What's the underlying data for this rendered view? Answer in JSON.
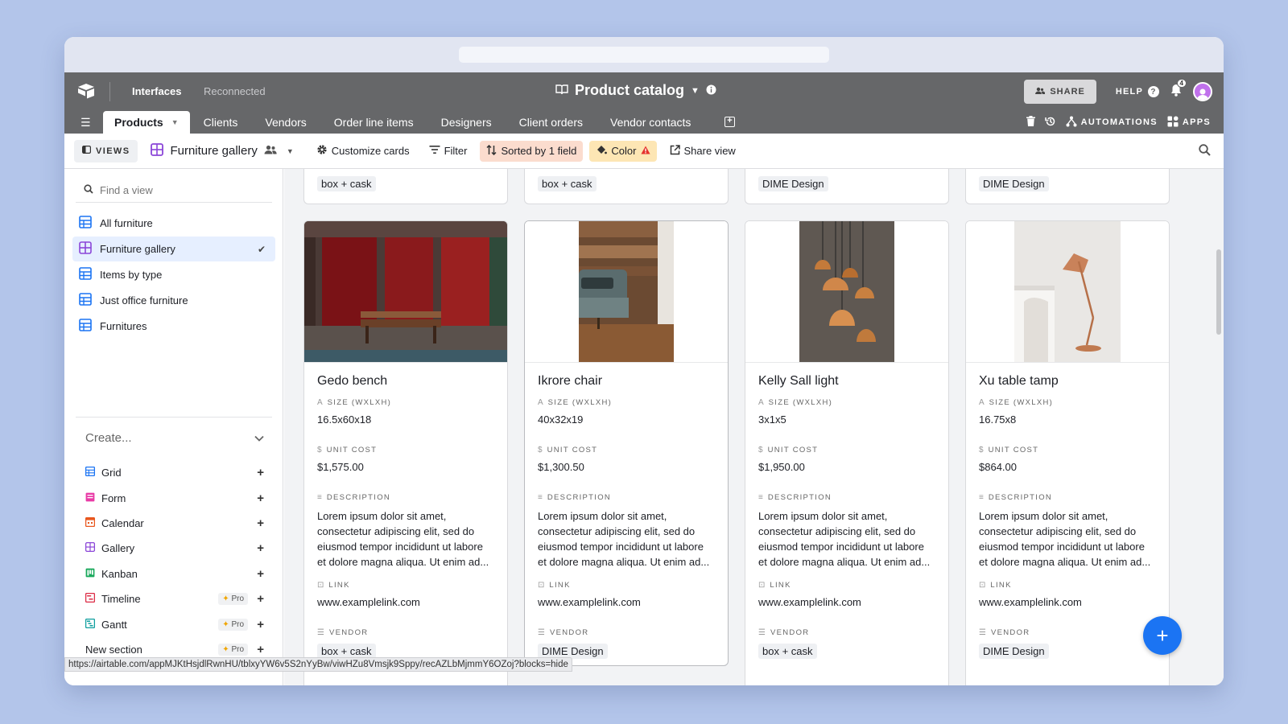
{
  "header": {
    "interfaces": "Interfaces",
    "status": "Reconnected",
    "base_title": "Product catalog",
    "share": "SHARE",
    "help": "HELP",
    "notif_count": "4"
  },
  "tabs": {
    "items": [
      "Products",
      "Clients",
      "Vendors",
      "Order line items",
      "Designers",
      "Client orders",
      "Vendor contacts"
    ],
    "automations": "AUTOMATIONS",
    "apps": "APPS"
  },
  "viewbar": {
    "views": "VIEWS",
    "current_view": "Furniture gallery",
    "customize": "Customize cards",
    "filter": "Filter",
    "sorted": "Sorted by 1 field",
    "color": "Color",
    "share_view": "Share view"
  },
  "sidebar": {
    "find_placeholder": "Find a view",
    "views": [
      "All furniture",
      "Furniture gallery",
      "Items by type",
      "Just office furniture",
      "Furnitures"
    ],
    "create": "Create...",
    "create_items": [
      "Grid",
      "Form",
      "Calendar",
      "Gallery",
      "Kanban",
      "Timeline",
      "Gantt",
      "New section"
    ],
    "pro": "Pro"
  },
  "top_cards": [
    "box + cask",
    "box + cask",
    "DIME Design",
    "DIME Design"
  ],
  "labels": {
    "size": "SIZE (WXLXH)",
    "unit_cost": "UNIT COST",
    "description": "DESCRIPTION",
    "link": "LINK",
    "vendor": "VENDOR"
  },
  "cards": [
    {
      "name": "Gedo bench",
      "size": "16.5x60x18",
      "cost": "$1,575.00",
      "desc": "Lorem ipsum dolor sit amet, consectetur adipiscing elit, sed do eiusmod tempor incididunt ut labore et dolore magna aliqua. Ut enim ad...",
      "link": "www.examplelink.com",
      "vendor": "box + cask"
    },
    {
      "name": "Ikrore chair",
      "size": "40x32x19",
      "cost": "$1,300.50",
      "desc": "Lorem ipsum dolor sit amet, consectetur adipiscing elit, sed do eiusmod tempor incididunt ut labore et dolore magna aliqua. Ut enim ad...",
      "link": "www.examplelink.com",
      "vendor": "DIME Design"
    },
    {
      "name": "Kelly Sall light",
      "size": "3x1x5",
      "cost": "$1,950.00",
      "desc": "Lorem ipsum dolor sit amet, consectetur adipiscing elit, sed do eiusmod tempor incididunt ut labore et dolore magna aliqua. Ut enim ad...",
      "link": "www.examplelink.com",
      "vendor": "box + cask"
    },
    {
      "name": "Xu table tamp",
      "size": "16.75x8",
      "cost": "$864.00",
      "desc": "Lorem ipsum dolor sit amet, consectetur adipiscing elit, sed do eiusmod tempor incididunt ut labore et dolore magna aliqua. Ut enim ad...",
      "link": "www.examplelink.com",
      "vendor": "DIME Design"
    }
  ],
  "status_url": "https://airtable.com/appMJKtHsjdlRwnHU/tblxyYW6v5S2nYyBw/viwHZu8Vmsjk9Sppy/recAZLbMjmmY6OZoj?blocks=hide",
  "colors": {
    "header_bg": "#666769",
    "accent": "#1b74f3",
    "selected_view": "#e6efff"
  }
}
